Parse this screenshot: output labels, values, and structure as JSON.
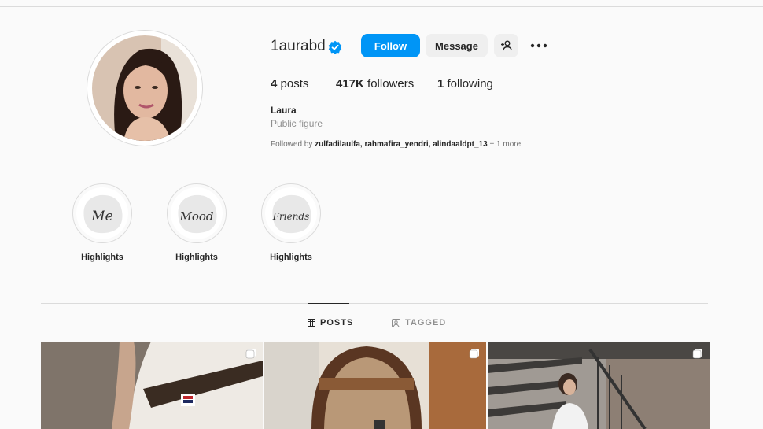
{
  "profile": {
    "username": "1aurabd",
    "full_name": "Laura",
    "category": "Public figure",
    "follow_label": "Follow",
    "message_label": "Message",
    "stats": {
      "posts_count": "4",
      "posts_label": "posts",
      "followers_count": "417K",
      "followers_label": "followers",
      "following_count": "1",
      "following_label": "following"
    },
    "followed_by": {
      "prefix": "Followed by",
      "names": "zulfadilaulfa, rahmafira_yendri, alindaaldpt_13",
      "suffix": "+ 1 more"
    }
  },
  "highlights": [
    {
      "label": "Highlights",
      "cover_text": "Me"
    },
    {
      "label": "Highlights",
      "cover_text": "Mood"
    },
    {
      "label": "Highlights",
      "cover_text": "Friends"
    }
  ],
  "tabs": [
    {
      "label": "POSTS",
      "icon": "grid-icon",
      "active": true
    },
    {
      "label": "TAGGED",
      "icon": "tag-icon",
      "active": false
    }
  ],
  "colors": {
    "accent": "#0095f6",
    "verified": "#0095f6",
    "text": "#262626",
    "muted": "#8e8e8e"
  }
}
